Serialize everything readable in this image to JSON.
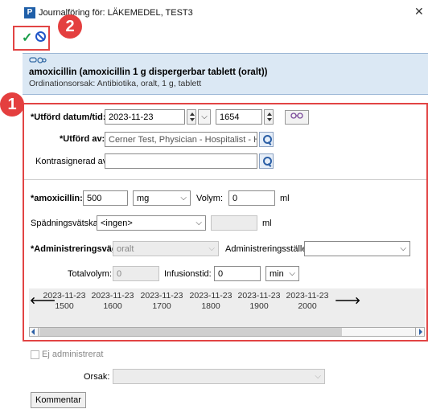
{
  "window": {
    "app_icon_letter": "P",
    "title": "Journalföring för: LÄKEMEDEL, TEST3",
    "close_glyph": "✕"
  },
  "toolbar": {
    "save_glyph": "✓",
    "badge_2": "2",
    "badge_1": "1"
  },
  "order": {
    "title": "amoxicillin (amoxicillin 1 g dispergerbar tablett (oralt))",
    "subtitle": "Ordinationsorsak: Antibiotika, oralt, 1 g, tablett"
  },
  "form": {
    "performed_datetime_label": "*Utförd datum/tid:",
    "date_value": "2023-11-23",
    "time_value": "1654",
    "performed_by_label": "*Utförd av:",
    "performed_by_value": "Cerner Test, Physician - Hospitalist - HSAID",
    "cosigned_by_label": "Kontrasignerad av:",
    "cosigned_by_value": "",
    "drug_label": "*amoxicillin:",
    "dose_value": "500",
    "unit_value": "mg",
    "volume_label": "Volym:",
    "volume_value": "0",
    "volume_unit": "ml",
    "diluent_label": "Spädningsvätska:",
    "diluent_value": "<ingen>",
    "diluent_volume_value": "",
    "diluent_unit": "ml",
    "route_label": "*Administreringsväg:",
    "route_value": "oralt",
    "site_label": "Administreringsställe:",
    "site_value": "",
    "total_volume_label": "Totalvolym:",
    "total_volume_value": "0",
    "infusion_time_label": "Infusionstid:",
    "infusion_time_value": "0",
    "infusion_unit_value": "min"
  },
  "timeline": {
    "slots": [
      {
        "date": "2023-11-23",
        "time": "1500"
      },
      {
        "date": "2023-11-23",
        "time": "1600"
      },
      {
        "date": "2023-11-23",
        "time": "1700"
      },
      {
        "date": "2023-11-23",
        "time": "1800"
      },
      {
        "date": "2023-11-23",
        "time": "1900"
      },
      {
        "date": "2023-11-23",
        "time": "2000"
      }
    ]
  },
  "footer": {
    "not_administered_label": "Ej administrerat",
    "reason_label": "Orsak:",
    "reason_value": "",
    "comment_button": "Kommentar"
  },
  "colors": {
    "highlight_red": "#e24444",
    "header_bg": "#dbe8f4",
    "save_green": "#1a9e4a",
    "cancel_blue": "#2156c8"
  },
  "icons": {
    "save": "checkmark-icon",
    "cancel": "prohibit-icon",
    "search": "magnifier-icon",
    "medication": "medication-icon"
  }
}
